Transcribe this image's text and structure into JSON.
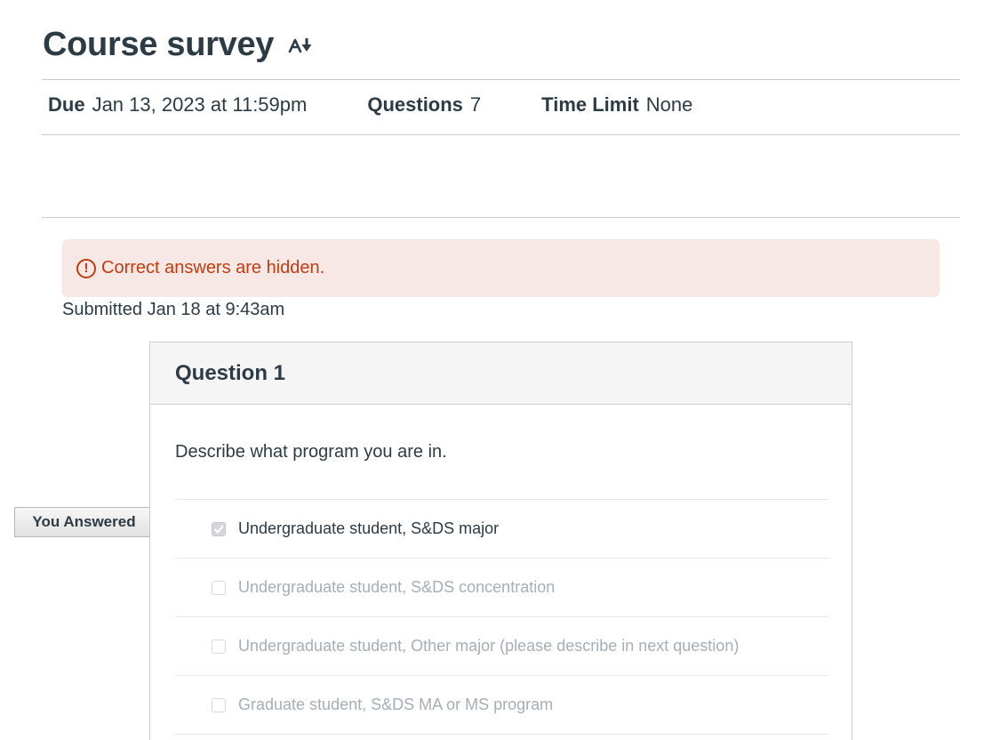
{
  "header": {
    "title": "Course survey",
    "title_icon": "text-direction-icon"
  },
  "meta": {
    "due_label": "Due",
    "due_value": "Jan 13, 2023 at 11:59pm",
    "questions_label": "Questions",
    "questions_value": "7",
    "time_limit_label": "Time Limit",
    "time_limit_value": "None"
  },
  "alert": {
    "icon": "exclamation-circle-icon",
    "text": "Correct answers are hidden."
  },
  "submitted": "Submitted Jan 18 at 9:43am",
  "question": {
    "title": "Question 1",
    "text": "Describe what program you are in.",
    "answered_tag": "You Answered",
    "answers": [
      {
        "label": "Undergraduate student, S&DS major",
        "checked": true
      },
      {
        "label": "Undergraduate student, S&DS concentration",
        "checked": false
      },
      {
        "label": "Undergraduate student, Other major (please describe in next question)",
        "checked": false
      },
      {
        "label": "Graduate student, S&DS MA or MS program",
        "checked": false
      }
    ]
  },
  "colors": {
    "text": "#2d3b45",
    "alert_bg": "#f7e8e6",
    "alert_text": "#c23c0d",
    "muted_text": "#a5afb5",
    "border": "#c7cdd1"
  }
}
